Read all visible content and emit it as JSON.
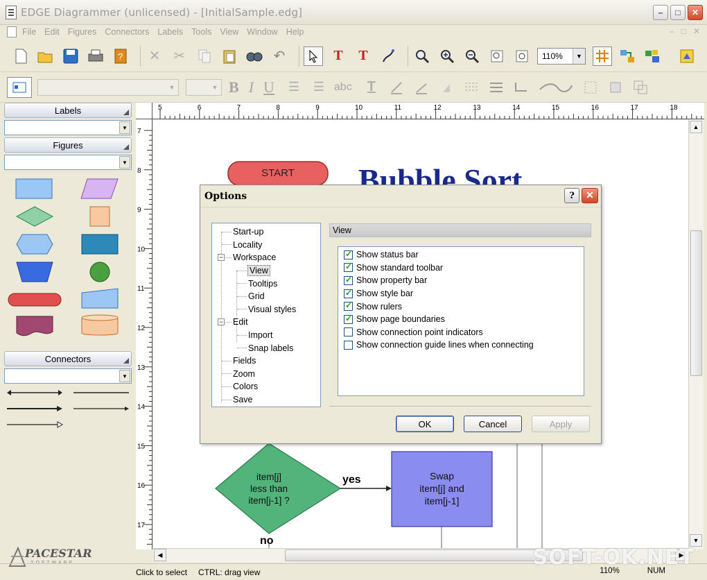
{
  "window": {
    "title": "EDGE Diagrammer (unlicensed) - [InitialSample.edg]",
    "minimize_label": "–",
    "maximize_label": "□",
    "close_label": "✕"
  },
  "menu": {
    "items": [
      "File",
      "Edit",
      "Figures",
      "Connectors",
      "Labels",
      "Tools",
      "View",
      "Window",
      "Help"
    ],
    "doc_controls": [
      "–",
      "□",
      "✕"
    ]
  },
  "toolbar": {
    "zoom_value": "110%"
  },
  "style_bar": {
    "bold": "B",
    "italic": "I",
    "underline": "U",
    "abc": "abc"
  },
  "left_panel": {
    "labels_title": "Labels",
    "figures_title": "Figures",
    "connectors_title": "Connectors",
    "logo_text": "PACESTAR",
    "logo_sub": "SOFTWARE"
  },
  "ruler": {
    "top_ticks": [
      "5",
      "6",
      "7",
      "8",
      "9",
      "10",
      "11",
      "12",
      "13",
      "14",
      "15",
      "16",
      "17",
      "18"
    ],
    "left_ticks": [
      "7",
      "8",
      "9",
      "10",
      "11",
      "12",
      "13",
      "14",
      "15",
      "16",
      "17"
    ]
  },
  "canvas": {
    "start_label": "START",
    "heading": "Bubble Sort",
    "decision_text": [
      "item[j]",
      "less than",
      "item[j-1] ?"
    ],
    "yes_label": "yes",
    "no_label": "no",
    "swap_text": [
      "Swap",
      "item[j] and",
      "item[j-1]"
    ]
  },
  "dialog": {
    "title": "Options",
    "help_label": "?",
    "close_label": "✕",
    "tree": [
      {
        "label": "Start-up",
        "level": 0
      },
      {
        "label": "Locality",
        "level": 0
      },
      {
        "label": "Workspace",
        "level": 0,
        "toggle": "−"
      },
      {
        "label": "View",
        "level": 1,
        "selected": true
      },
      {
        "label": "Tooltips",
        "level": 1
      },
      {
        "label": "Grid",
        "level": 1
      },
      {
        "label": "Visual styles",
        "level": 1
      },
      {
        "label": "Edit",
        "level": 0,
        "toggle": "−"
      },
      {
        "label": "Import",
        "level": 1
      },
      {
        "label": "Snap labels",
        "level": 1
      },
      {
        "label": "Fields",
        "level": 0
      },
      {
        "label": "Zoom",
        "level": 0
      },
      {
        "label": "Colors",
        "level": 0
      },
      {
        "label": "Save",
        "level": 0
      }
    ],
    "section_title": "View",
    "options": [
      {
        "label": "Show status bar",
        "checked": true
      },
      {
        "label": "Show standard toolbar",
        "checked": true
      },
      {
        "label": "Show property bar",
        "checked": true
      },
      {
        "label": "Show style bar",
        "checked": true
      },
      {
        "label": "Show rulers",
        "checked": true
      },
      {
        "label": "Show page boundaries",
        "checked": true
      },
      {
        "label": "Show connection point indicators",
        "checked": false
      },
      {
        "label": "Show connection guide lines when connecting",
        "checked": false
      }
    ],
    "ok_label": "OK",
    "cancel_label": "Cancel",
    "apply_label": "Apply"
  },
  "status": {
    "hint1": "Click to select",
    "hint2": "CTRL: drag view",
    "zoom": "110%",
    "num": "NUM"
  },
  "watermark": "SOFT-OK.NET"
}
